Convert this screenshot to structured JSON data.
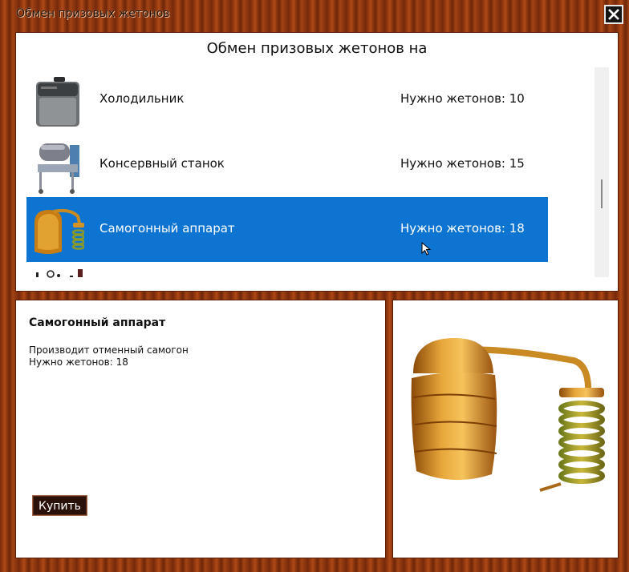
{
  "window": {
    "title": "Обмен призовых жетонов",
    "close_icon": "close-icon"
  },
  "list": {
    "heading": "Обмен призовых жетонов на",
    "items": [
      {
        "name": "Холодильник",
        "cost": "Нужно жетонов: 10",
        "icon": "fridge-icon",
        "selected": false
      },
      {
        "name": "Консервный станок",
        "cost": "Нужно жетонов: 15",
        "icon": "canning-machine-icon",
        "selected": false
      },
      {
        "name": "Самогонный аппарат",
        "cost": "Нужно жетонов: 18",
        "icon": "moonshine-still-icon",
        "selected": true
      }
    ]
  },
  "detail": {
    "title": "Самогонный аппарат",
    "description": "Производит отменный самогон",
    "cost": "Нужно жетонов: 18",
    "buy_label": "Купить",
    "image_icon": "moonshine-still-icon"
  },
  "colors": {
    "selection": "#0e74d2",
    "wood": "#93390f",
    "button_bg": "#2a120a"
  }
}
